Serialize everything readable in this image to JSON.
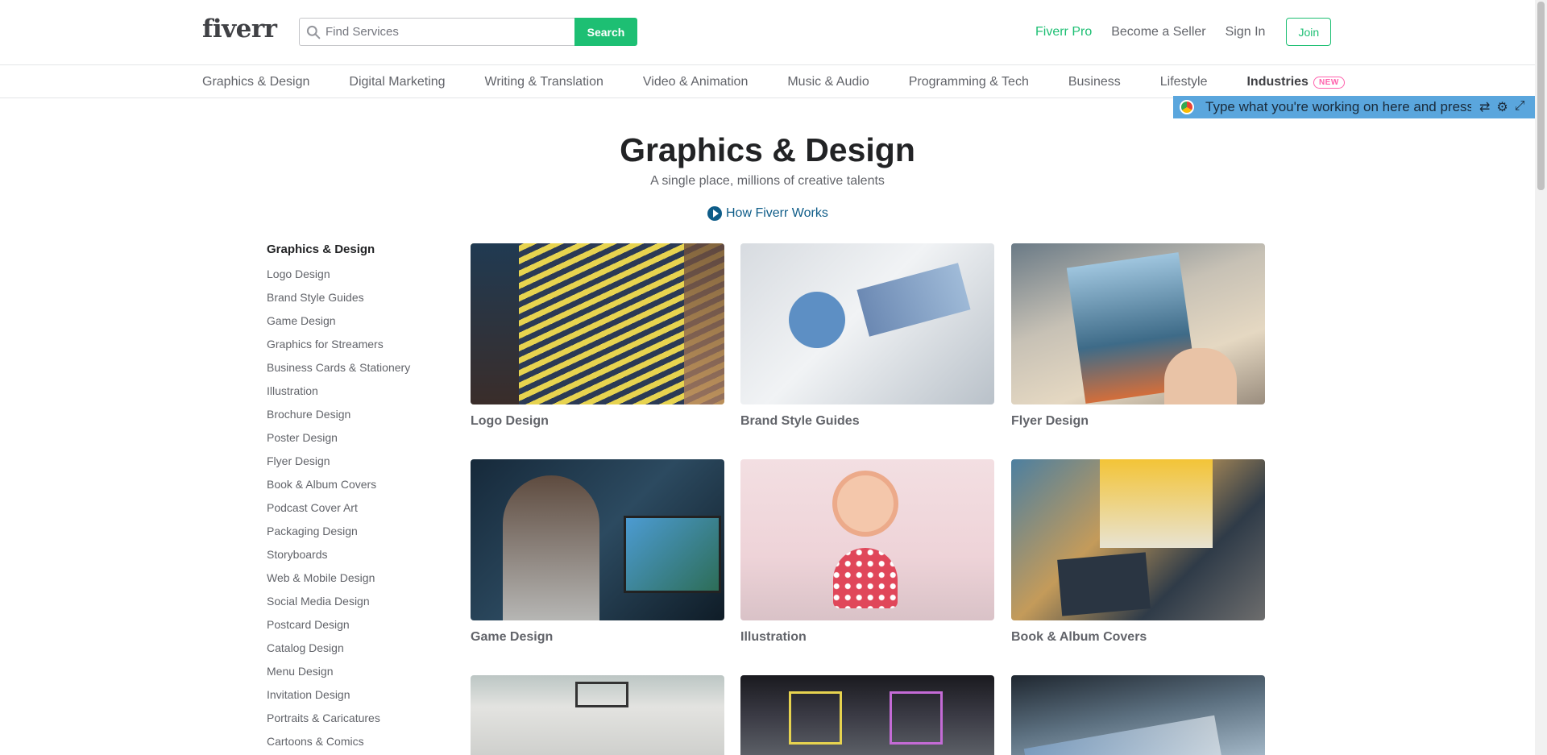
{
  "header": {
    "logo": "fiverr",
    "search_placeholder": "Find Services",
    "search_button": "Search",
    "nav": [
      {
        "label": "Fiverr Pro",
        "accent": true
      },
      {
        "label": "Become a Seller",
        "accent": false
      },
      {
        "label": "Sign In",
        "accent": false
      }
    ],
    "join": "Join"
  },
  "category_nav": {
    "items": [
      "Graphics & Design",
      "Digital Marketing",
      "Writing & Translation",
      "Video & Animation",
      "Music & Audio",
      "Programming & Tech",
      "Business",
      "Lifestyle"
    ],
    "industries": "Industries",
    "badge": "NEW"
  },
  "float_bar": {
    "text": "Type what you're working on here and press"
  },
  "hero": {
    "title": "Graphics & Design",
    "subtitle": "A single place, millions of creative talents",
    "how_link": "How Fiverr Works"
  },
  "sidebar": {
    "heading": "Graphics & Design",
    "links": [
      "Logo Design",
      "Brand Style Guides",
      "Game Design",
      "Graphics for Streamers",
      "Business Cards & Stationery",
      "Illustration",
      "Brochure Design",
      "Poster Design",
      "Flyer Design",
      "Book & Album Covers",
      "Podcast Cover Art",
      "Packaging Design",
      "Storyboards",
      "Web & Mobile Design",
      "Social Media Design",
      "Postcard Design",
      "Catalog Design",
      "Menu Design",
      "Invitation Design",
      "Portraits & Caricatures",
      "Cartoons & Comics"
    ]
  },
  "cards": [
    {
      "name": "Logo Design",
      "image": "img-logo"
    },
    {
      "name": "Brand Style Guides",
      "image": "img-brand"
    },
    {
      "name": "Flyer Design",
      "image": "img-flyer"
    },
    {
      "name": "Game Design",
      "image": "img-game"
    },
    {
      "name": "Illustration",
      "image": "img-illus"
    },
    {
      "name": "Book & Album Covers",
      "image": "img-book"
    },
    {
      "name": "",
      "image": "img-r3a"
    },
    {
      "name": "",
      "image": "img-r3b"
    },
    {
      "name": "",
      "image": "img-r3c"
    }
  ],
  "colors": {
    "accent": "#1dbf73",
    "badge": "#ff62ad",
    "link": "#0e5c88",
    "float_bar": "#5aa6dd"
  }
}
